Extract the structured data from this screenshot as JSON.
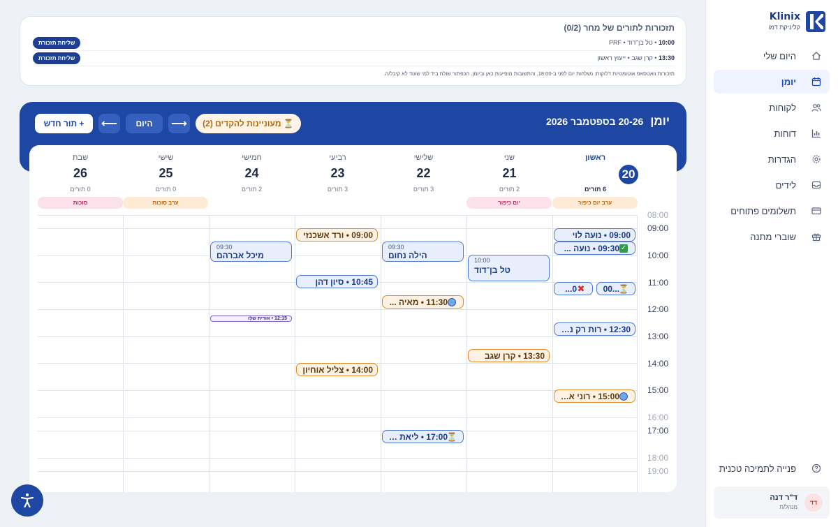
{
  "brand": {
    "name": "Klinix",
    "subtitle": "קליניקת דמו"
  },
  "sidebar": {
    "items": [
      {
        "label": "היום שלי",
        "icon": "home-icon",
        "active": false
      },
      {
        "label": "יומן",
        "icon": "calendar-icon",
        "active": true
      },
      {
        "label": "לקוחות",
        "icon": "users-icon",
        "active": false
      },
      {
        "label": "דוחות",
        "icon": "bar-chart-icon",
        "active": false
      },
      {
        "label": "הגדרות",
        "icon": "gear-icon",
        "active": false
      },
      {
        "label": "לידים",
        "icon": "inbox-icon",
        "active": false
      },
      {
        "label": "תשלומים פתוחים",
        "icon": "credit-card-icon",
        "active": false
      },
      {
        "label": "שוברי מתנה",
        "icon": "gift-icon",
        "active": false
      }
    ],
    "support": "פנייה לתמיכה טכנית",
    "user": {
      "initials": "דד",
      "name": "ד\"ר דנה",
      "role": "מנהל/ת"
    }
  },
  "reminders": {
    "title": "תזכורות לתורים של מחר (0/2)",
    "rows": [
      {
        "time": "10:00",
        "rest": " • טל בן־דוד • PRF",
        "button": "שליחת תזכורת"
      },
      {
        "time": "13:30",
        "rest": " • קרן שגב • ייעוץ ראשון",
        "button": "שליחת תזכורת"
      }
    ],
    "note": "תזכורות וואטסאפ אוטומטיות דלוקות: נשלחות יום לפני ב-18:00, והתשובות מופיעות כאן וביומן. הכפתור שולח ביד למי שעוד לא קיבל/ה."
  },
  "calendar": {
    "title_label": "יומן",
    "range": "20-26 בספטמבר 2026",
    "new_button": "+ תור חדש",
    "today_button": "היום",
    "prev_arrow": "⟵",
    "next_arrow": "⟶",
    "waitlist_button": "⏳ מעוניינות להקדים (2)",
    "days": [
      {
        "name": "ראשון",
        "num": "20",
        "count": "6 תורים",
        "today": true,
        "holiday": "ערב יום כיפור",
        "holiday_color": "orange"
      },
      {
        "name": "שני",
        "num": "21",
        "count": "2 תורים",
        "today": false,
        "holiday": "יום כיפור",
        "holiday_color": "pink"
      },
      {
        "name": "שלישי",
        "num": "22",
        "count": "3 תורים",
        "today": false,
        "holiday": "",
        "holiday_color": ""
      },
      {
        "name": "רביעי",
        "num": "23",
        "count": "3 תורים",
        "today": false,
        "holiday": "",
        "holiday_color": ""
      },
      {
        "name": "חמישי",
        "num": "24",
        "count": "2 תורים",
        "today": false,
        "holiday": "",
        "holiday_color": ""
      },
      {
        "name": "שישי",
        "num": "25",
        "count": "0 תורים",
        "today": false,
        "holiday": "ערב סוכות",
        "holiday_color": "orange"
      },
      {
        "name": "שבת",
        "num": "26",
        "count": "0 תורים",
        "today": false,
        "holiday": "סוכות",
        "holiday_color": "pink"
      }
    ],
    "hours": [
      "08:00",
      "09:00",
      "10:00",
      "11:00",
      "12:00",
      "13:00",
      "14:00",
      "15:00",
      "16:00",
      "17:00",
      "18:00",
      "19:00"
    ],
    "events": {
      "e1": "09:00 • נועה לוי",
      "e2": "09:30 • נועה ...",
      "e3": "0...",
      "e4": "...00",
      "e5": "12:30 • רות רק נש...",
      "e6": "15:00 • רוני אל...",
      "e7_time": "10:00",
      "e7_name": "טל בן־דוד",
      "e8": "13:30 • קרן שגב",
      "e9_time": "09:30",
      "e9_name": "הילה נחום",
      "e10": "11:30 • מאיה ...",
      "e11": "17:00 • ליאת א...",
      "e12": "09:00 • ורד אשכנזי",
      "e13": "10:45 • סיון דהן",
      "e14": "14:00 • צליל אוחיון",
      "e15_time": "09:30",
      "e15_name": "מיכל אברהם",
      "e16": "12:15 • אורית שלו"
    }
  }
}
